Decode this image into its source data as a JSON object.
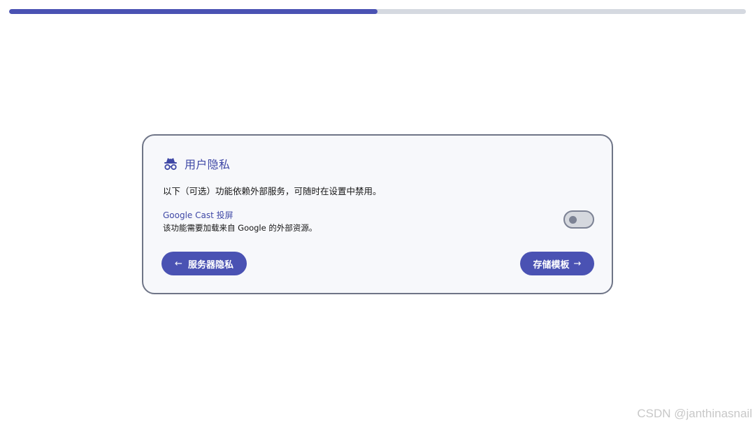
{
  "progress": {
    "percent": 50,
    "fill_color": "#4a52b3",
    "track_color": "#d5d9e0"
  },
  "privacy_card": {
    "icon": "incognito-icon",
    "title": "用户隐私",
    "description": "以下（可选）功能依赖外部服务，可随时在设置中禁用。",
    "settings": [
      {
        "label": "Google Cast 投屏",
        "description": "该功能需要加载来自 Google 的外部资源。",
        "enabled": false
      }
    ],
    "back_button": {
      "icon": "arrow-left-icon",
      "label": "服务器隐私"
    },
    "next_button": {
      "label": "存储模板",
      "icon": "arrow-right-icon"
    }
  },
  "watermark": "CSDN @janthinasnail",
  "colors": {
    "accent": "#4a52b3",
    "card_background": "#f7f8fb",
    "card_border": "#6f7587"
  }
}
